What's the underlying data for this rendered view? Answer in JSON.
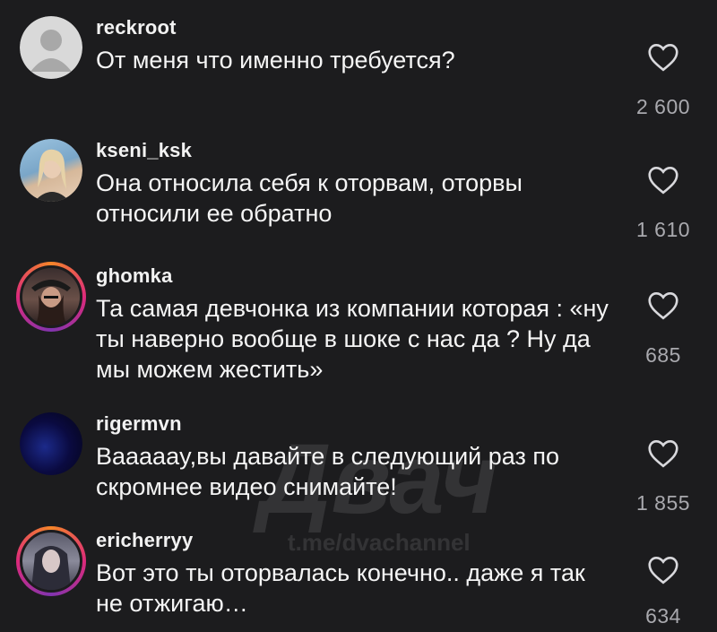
{
  "watermark": {
    "logo": "Двач",
    "url": "t.me/dvachannel"
  },
  "comments": [
    {
      "username": "reckroot",
      "text": "От меня что именно требуется?",
      "likes": "2 600",
      "avatar_icon": "default-avatar-icon",
      "avatar_color": "#d9d9d9"
    },
    {
      "username": "kseni_ksk",
      "text": "Она относила себя к оторвам, оторвы относили ее обратно",
      "likes": "1 610",
      "avatar_icon": "user-photo",
      "avatar_color": "#8fb8d8"
    },
    {
      "username": "ghomka",
      "text": "Та самая девчонка из компании которая : «ну ты наверно вообще в шоке с нас да ? Ну да мы можем жестить»",
      "likes": "685",
      "avatar_icon": "user-photo",
      "avatar_color": "#5a4a4a"
    },
    {
      "username": "rigermvn",
      "text": "Ваааааy,вы давайте в следующий раз по скромнее видео снимайте!",
      "likes": "1 855",
      "avatar_icon": "user-photo",
      "avatar_color": "#0a0a3a"
    },
    {
      "username": "ericherryy",
      "text": "Вот это ты оторвалась  конечно.. даже я так не отжигаю…",
      "likes": "634",
      "avatar_icon": "user-photo",
      "avatar_color": "#6a6a80"
    }
  ]
}
